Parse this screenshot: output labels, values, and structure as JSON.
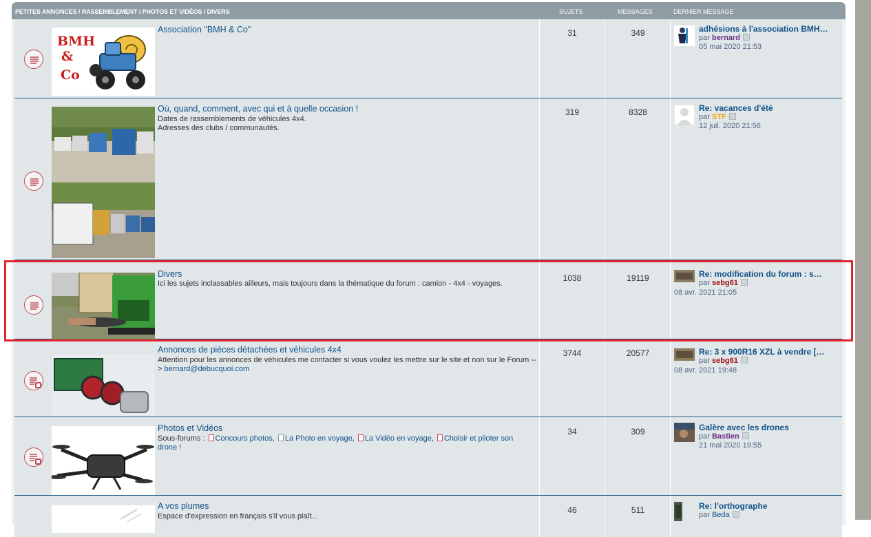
{
  "header": {
    "forum_col": "PETITES ANNONCES / RASSEMBLEMENT / PHOTOS ET VIDÉOS / DIVERS",
    "topics_col": "SUJETS",
    "posts_col": "MESSAGES",
    "last_col": "DERNIER MESSAGE"
  },
  "forums": [
    {
      "title": "Association \"BMH & Co\"",
      "topics": "31",
      "posts": "349",
      "last_title": "adhésions à l'association BMH…",
      "last_by_prefix": "par",
      "last_author": "bernard",
      "last_author_color": "#6a2f84",
      "last_date": "05 mai 2020 21:53",
      "thumb_text_1": "BMH",
      "thumb_text_2": "&",
      "thumb_text_3": "Co"
    },
    {
      "title": "Où, quand, comment, avec qui et à quelle occasion !",
      "desc_line1": "Dates de rassemblements de véhicules 4x4.",
      "desc_line2": "Adresses des clubs / communautés.",
      "topics": "319",
      "posts": "8328",
      "last_title": "Re: vacances d'été",
      "last_by_prefix": "par",
      "last_author": "STF",
      "last_author_color": "#f0a800",
      "last_date": "12 juil. 2020 21:56"
    },
    {
      "title": "Divers",
      "desc": "Ici les sujets inclassables ailleurs, mais toujours dans la thématique du forum : camion - 4x4 - voyages.",
      "topics": "1038",
      "posts": "19119",
      "last_title": "Re: modification du forum : s…",
      "last_by_prefix": "par",
      "last_author": "sebg61",
      "last_author_color": "#a01010",
      "last_date": "08 avr. 2021 21:05"
    },
    {
      "title": "Annonces de pièces détachées et véhicules 4x4",
      "desc_text": "Attention pour les annonces de véhicules me contacter si vous voulez les mettre sur le site et non sur le Forum --> ",
      "desc_link": "bernard@debucquoi.com",
      "topics": "3744",
      "posts": "20577",
      "last_title": "Re: 3 x 900R16 XZL à vendre […",
      "last_by_prefix": "par",
      "last_author": "sebg61",
      "last_author_color": "#a01010",
      "last_date": "08 avr. 2021 19:48"
    },
    {
      "title": "Photos et Vidéos",
      "subforums_label": "Sous-forums :",
      "subforums": [
        "Concours photos",
        "La Photo en voyage",
        "La Vidéo en voyage",
        "Choisir et piloter son drone !"
      ],
      "topics": "34",
      "posts": "309",
      "last_title": "Galère avec les drones",
      "last_by_prefix": "par",
      "last_author": "Bastien",
      "last_author_color": "#6a2f84",
      "last_date": "21 mai 2020 19:55"
    },
    {
      "title": "A vos plumes",
      "desc": "Espace d'expression en français s'il vous plaît...",
      "topics": "46",
      "posts": "511",
      "last_title": "Re: l'orthographe",
      "last_by_prefix": "par",
      "last_author": "Beda",
      "last_author_color": "#105289"
    }
  ],
  "colors": {
    "header_bg": "#8f9ca4",
    "row_bg": "#e1e6e9",
    "link": "#105289",
    "highlight": "#e0232e",
    "icon": "#c14a57"
  }
}
